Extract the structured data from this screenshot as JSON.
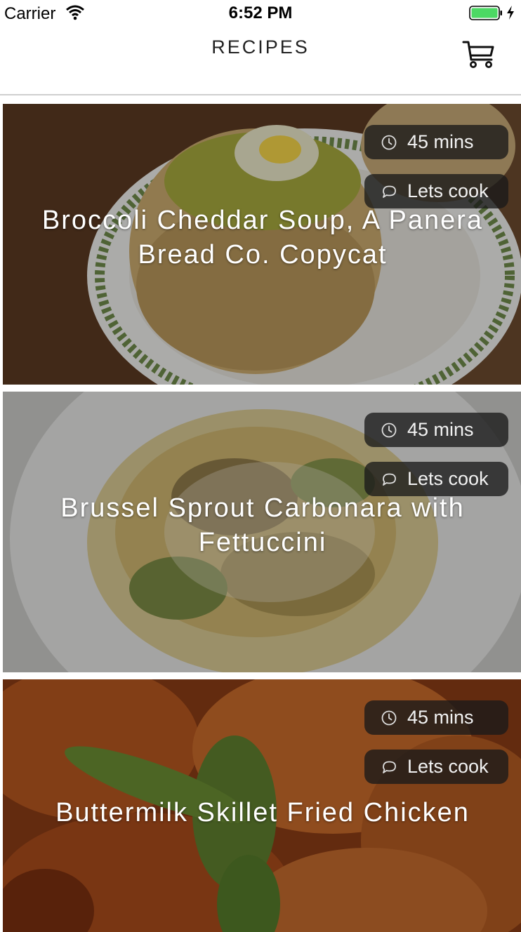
{
  "status_bar": {
    "carrier": "Carrier",
    "time": "6:52 PM",
    "battery_color": "#4cd964"
  },
  "nav": {
    "title": "RECIPES",
    "cart_icon": "shopping-cart-icon"
  },
  "recipes": [
    {
      "title": "Broccoli Cheddar Soup, A Panera Bread Co. Copycat",
      "time": "45 mins",
      "action": "Lets cook",
      "image": "bread bowl of broccoli cheddar soup on a plate"
    },
    {
      "title": "Brussel Sprout Carbonara with Fettuccini",
      "time": "45 mins",
      "action": "Lets cook",
      "image": "fettuccini with brussel sprouts and parmesan"
    },
    {
      "title": "Buttermilk Skillet Fried Chicken",
      "time": "45 mins",
      "action": "Lets cook",
      "image": "fried chicken pieces with basil"
    }
  ]
}
